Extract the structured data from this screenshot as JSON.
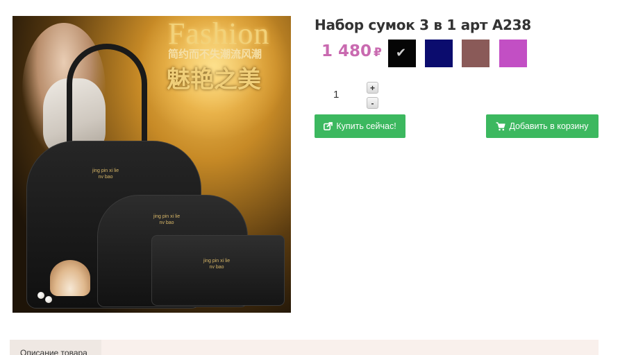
{
  "product": {
    "title": "Набор сумок 3 в 1 арт A238",
    "price": "1 480",
    "currency": "₽",
    "image": {
      "headline": "Fashion",
      "slogan_line1": "简约而不失潮流风潮",
      "slogan_line2": "魅艳之美",
      "bag_logo_line1": "jing pin xi lie",
      "bag_logo_line2": "nv bao"
    }
  },
  "colors": {
    "swatches": [
      {
        "name": "black",
        "hex": "#050505",
        "selected": true
      },
      {
        "name": "navy",
        "hex": "#0b0c6e",
        "selected": false
      },
      {
        "name": "dusty-rose",
        "hex": "#8a5a58",
        "selected": false
      },
      {
        "name": "orchid",
        "hex": "#c24fc4",
        "selected": false
      }
    ],
    "price": "#c96ab0",
    "button": "#3cb85f"
  },
  "quantity": {
    "value": "1",
    "plus_label": "+",
    "minus_label": "-"
  },
  "actions": {
    "buy_now_label": "Купить сейчас!",
    "add_to_cart_label": "Добавить в корзину"
  },
  "tabs": [
    {
      "label": "Описание товара",
      "active": true
    }
  ],
  "icons": {
    "buy_now": "share-square-icon",
    "add_to_cart": "shopping-cart-icon",
    "selected_swatch": "checkmark-icon"
  }
}
